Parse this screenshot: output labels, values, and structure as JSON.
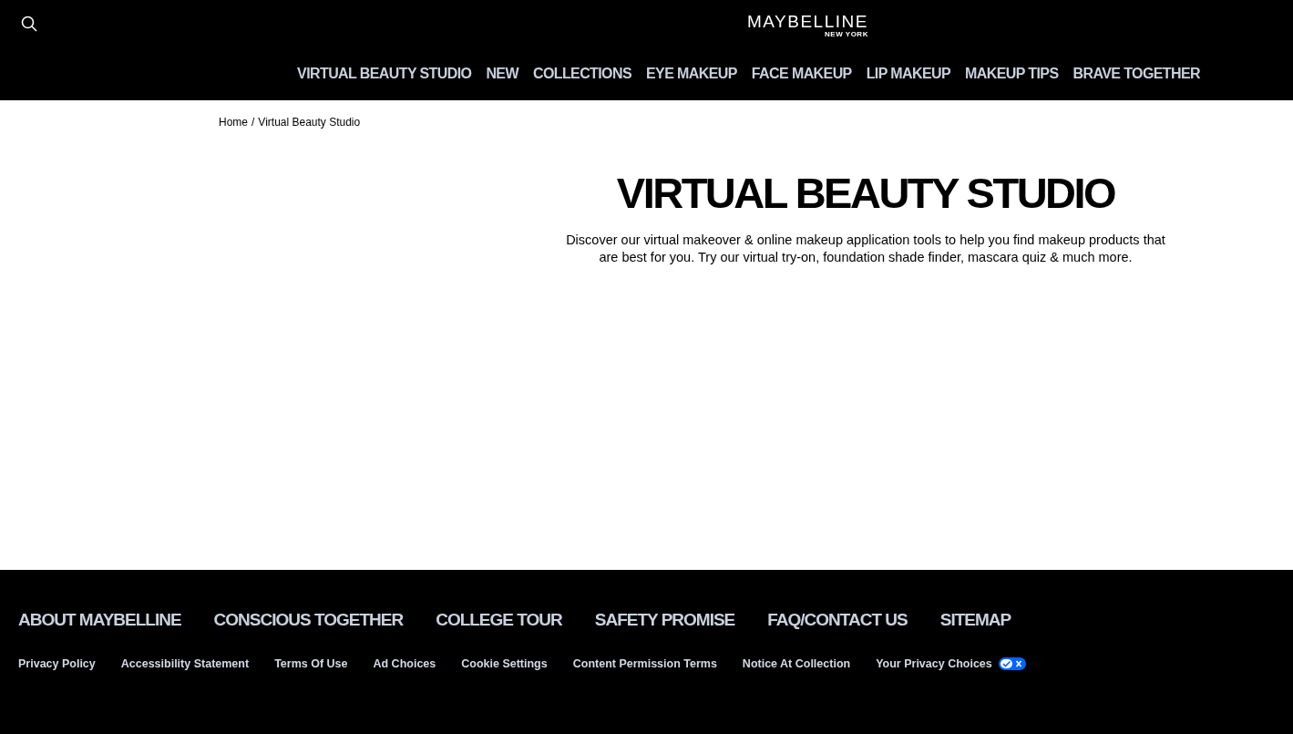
{
  "header": {
    "logo": {
      "name": "MAYBELLINE",
      "sub": "NEW YORK"
    },
    "nav": [
      "VIRTUAL BEAUTY STUDIO",
      "NEW",
      "COLLECTIONS",
      "EYE MAKEUP",
      "FACE MAKEUP",
      "LIP MAKEUP",
      "MAKEUP TIPS",
      "BRAVE TOGETHER"
    ]
  },
  "breadcrumb": [
    "Home",
    "Virtual Beauty Studio"
  ],
  "breadcrumb_separator": "/",
  "hero": {
    "title": "VIRTUAL BEAUTY STUDIO",
    "description": "Discover our virtual makeover & online makeup application tools to help you find makeup products that are best for you. Try our virtual try-on, foundation shade finder, mascara quiz & much more."
  },
  "footer": {
    "main_links": [
      "ABOUT MAYBELLINE",
      "CONSCIOUS TOGETHER",
      "COLLEGE TOUR",
      "SAFETY PROMISE",
      "FAQ/CONTACT US",
      "SITEMAP"
    ],
    "legal_links": [
      "Privacy Policy",
      "Accessibility Statement",
      "Terms Of Use",
      "Ad Choices",
      "Cookie Settings",
      "Content Permission Terms",
      "Notice At Collection",
      "Your Privacy Choices"
    ]
  }
}
